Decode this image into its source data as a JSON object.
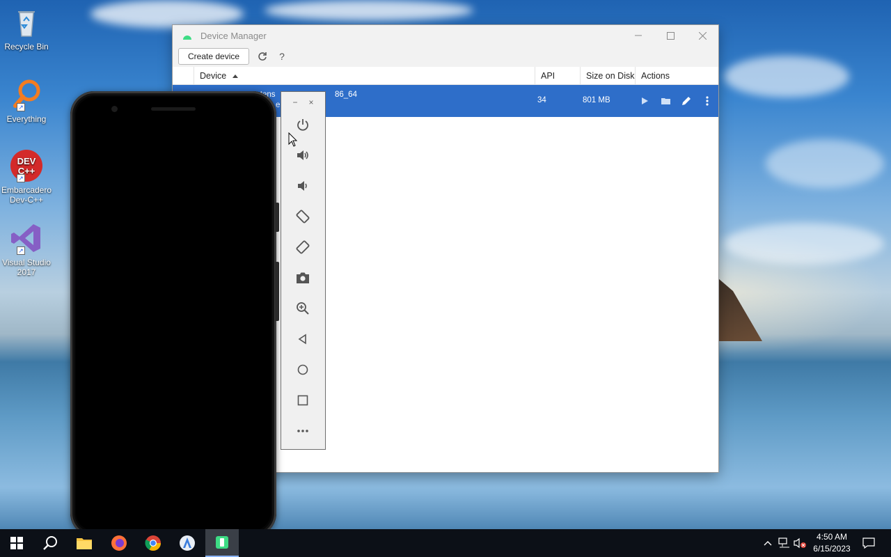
{
  "desktop": {
    "icons": [
      {
        "label_line1": "Recycle Bin",
        "label_line2": ""
      },
      {
        "label_line1": "Everything",
        "label_line2": ""
      },
      {
        "label_line1": "Embarcadero",
        "label_line2": "Dev-C++"
      },
      {
        "label_line1": "Visual Studio",
        "label_line2": "2017"
      }
    ]
  },
  "device_manager": {
    "title": "Device Manager",
    "toolbar": {
      "create_label": "Create device",
      "help_label": "?"
    },
    "columns": {
      "device": "Device",
      "api": "API",
      "size": "Size on Disk",
      "actions": "Actions"
    },
    "row": {
      "name_partial": "xtens",
      "name_suffix": "86_64",
      "name_line2_partial": "e",
      "api": "34",
      "size": "801 MB"
    }
  },
  "emulator_toolbar": {
    "minimize_label": "−",
    "close_label": "×",
    "items": [
      "power-icon",
      "volume-up-icon",
      "volume-down-icon",
      "rotate-left-icon",
      "rotate-right-icon",
      "camera-icon",
      "zoom-icon",
      "back-icon",
      "home-icon",
      "overview-icon",
      "more-icon"
    ]
  },
  "taskbar": {
    "time": "4:50 AM",
    "date": "6/15/2023",
    "tray_expand_label": "^"
  },
  "colors": {
    "selection_blue": "#2e6ec9",
    "taskbar_bg": "#0c1017"
  }
}
